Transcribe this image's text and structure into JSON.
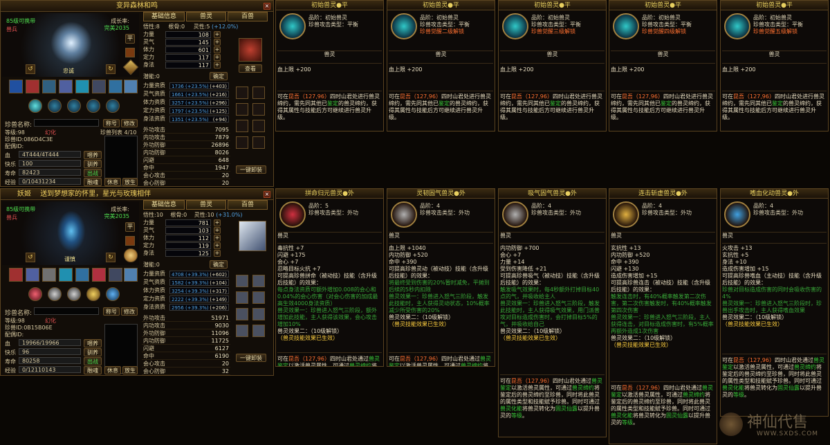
{
  "top_panel": {
    "title": "变异森林和鸣",
    "tabs": [
      "基础信息",
      "兽灵",
      "百兽"
    ],
    "carry": "85级可携带",
    "type_label": "兽兵",
    "growth_label": "成长率:",
    "growth_value": "完美2035",
    "pet_name_title": "忠诚",
    "pet_name_label": "珍兽名称:",
    "btn_title": "称号",
    "btn_modify": "修改",
    "btn_pin": "平",
    "level": "等级:98",
    "phantom": "幻化",
    "pet_id": "珍兽ID:086D4C3E",
    "spouse": "配偶ID:",
    "pet_list": "珍兽列表 4/10",
    "hp_label": "血",
    "hp_value": "4T444/4T444",
    "feed": "喂养",
    "happy_label": "快乐",
    "happy_value": "100",
    "tame": "驯养",
    "life_label": "寿命",
    "life_value": "82423",
    "out": "出战",
    "exp_label": "经验",
    "exp_value": "0/10431234",
    "btn_breed": "融魂",
    "btn_rest": "休息",
    "btn_release": "放生",
    "savvy": "悟性:8",
    "bone": "根骨:0",
    "spirit": "灵性:5",
    "spirit_bonus": "(+12.0%)",
    "attrs": [
      {
        "k": "力量",
        "v": "108"
      },
      {
        "k": "灵气",
        "v": "145"
      },
      {
        "k": "体力",
        "v": "601"
      },
      {
        "k": "定力",
        "v": "117"
      },
      {
        "k": "身法",
        "v": "117"
      }
    ],
    "potential": "潜能:0",
    "confirm": "确定",
    "look": "查看",
    "aptitudes": [
      {
        "k": "力量资质",
        "v": "1736 (+23.5%)",
        "b": "(+403)"
      },
      {
        "k": "灵气资质",
        "v": "1661 (+23.5%)",
        "b": "(+216)"
      },
      {
        "k": "体力资质",
        "v": "3257 (+23.5%)",
        "b": "(+296)"
      },
      {
        "k": "定力资质",
        "v": "1797 (+23.5%)",
        "b": "(+125)"
      },
      {
        "k": "身法资质",
        "v": "1351 (+23.5%)",
        "b": "(+94)"
      }
    ],
    "combat": [
      {
        "k": "外功攻击",
        "v": "7095"
      },
      {
        "k": "内功攻击",
        "v": "7879"
      },
      {
        "k": "外功防御",
        "v": "26896"
      },
      {
        "k": "内功防御",
        "v": "8026"
      },
      {
        "k": "闪避",
        "v": "648"
      },
      {
        "k": "命中",
        "v": "1947"
      },
      {
        "k": "会心攻击",
        "v": "20"
      },
      {
        "k": "会心防御",
        "v": "20"
      }
    ],
    "unload": "一键卸装"
  },
  "bottom_panel": {
    "title": "妖姬",
    "banner": "送到梦想家的怀里，星光与玫瑰相伴",
    "tabs": [
      "基础信息",
      "兽灵",
      "百兽"
    ],
    "carry": "85级可携带",
    "type_label": "兽兵",
    "growth_label": "成长率:",
    "growth_value": "完美2035",
    "pet_name_title": "谨慎",
    "pet_name_label": "珍兽名称:",
    "btn_title": "称号",
    "btn_modify": "修改",
    "btn_pin": "平",
    "level": "等级:98",
    "phantom": "幻化",
    "pet_id": "珍兽ID:0B15B06E",
    "spouse": "配偶ID:",
    "hp_label": "血",
    "hp_value": "19966/19966",
    "feed": "喂养",
    "happy_label": "快乐",
    "happy_value": "96",
    "tame": "驯养",
    "life_label": "寿命",
    "life_value": "80258",
    "out": "出战",
    "exp_label": "经验",
    "exp_value": "0/12110143",
    "btn_breed": "融魂",
    "btn_rest": "休息",
    "btn_release": "放生",
    "savvy": "悟性:10",
    "bone": "根骨:0",
    "spirit": "灵性:10",
    "spirit_bonus": "(+31.0%)",
    "attrs": [
      {
        "k": "力量",
        "v": "781"
      },
      {
        "k": "灵气",
        "v": "103"
      },
      {
        "k": "体力",
        "v": "112"
      },
      {
        "k": "定力",
        "v": "119"
      },
      {
        "k": "身法",
        "v": "125"
      }
    ],
    "potential": "潜能:0",
    "confirm": "确定",
    "aptitudes": [
      {
        "k": "力量资质",
        "v": "4708 (+39.3%)",
        "b": "(+602)"
      },
      {
        "k": "灵气资质",
        "v": "1582 (+39.3%)",
        "b": "(+104)"
      },
      {
        "k": "体力资质",
        "v": "3254 (+39.3%)",
        "b": "(+317)"
      },
      {
        "k": "定力资质",
        "v": "2222 (+39.3%)",
        "b": "(+149)"
      },
      {
        "k": "身法资质",
        "v": "2956 (+39.3%)",
        "b": "(+206)"
      }
    ],
    "combat": [
      {
        "k": "外功攻击",
        "v": "51971"
      },
      {
        "k": "内功攻击",
        "v": "9030"
      },
      {
        "k": "外功防御",
        "v": "11096"
      },
      {
        "k": "内功防御",
        "v": "11725"
      },
      {
        "k": "闪避",
        "v": "6127"
      },
      {
        "k": "命中",
        "v": "6190"
      },
      {
        "k": "会心攻击",
        "v": "20"
      },
      {
        "k": "会心防御",
        "v": "32"
      }
    ],
    "unload": "一键卸装"
  },
  "top_cards": [
    {
      "title": "初始兽灵●平",
      "grade": "品阶：初始兽灵",
      "atk_type": "珍兽攻击类型：平衡",
      "unlock": "",
      "stat": "血上限 +200",
      "orb_color": "#30c8c8"
    },
    {
      "title": "初始兽灵●平",
      "grade": "品阶：初始兽灵",
      "atk_type": "珍兽攻击类型：平衡",
      "unlock": "珍兽觉醒二级解锁",
      "stat": "血上限 +200",
      "orb_color": "#30c8c8"
    },
    {
      "title": "初始兽灵●平",
      "grade": "品阶：初始兽灵",
      "atk_type": "珍兽攻击类型：平衡",
      "unlock": "珍兽觉醒三级解锁",
      "stat": "血上限 +200",
      "orb_color": "#30c8c8"
    },
    {
      "title": "初始兽灵●平",
      "grade": "品阶：初始兽灵",
      "atk_type": "珍兽攻击类型：平衡",
      "unlock": "珍兽觉醒四级解锁",
      "stat": "血上限 +200",
      "orb_color": "#30c8c8"
    },
    {
      "title": "初始兽灵●平",
      "grade": "品阶：初始兽灵",
      "atk_type": "珍兽攻击类型：平衡",
      "unlock": "珍兽觉醒五级解锁",
      "stat": "血上限 +200",
      "orb_color": "#30c8c8"
    }
  ],
  "top_card_common": {
    "label": "兽灵",
    "desc_1": "可在",
    "desc_place": "昆吾（127,96）",
    "desc_2": "四时山君处进行兽灵缔约，需先同其他已",
    "desc_identify": "鉴定",
    "desc_3": "的兽灵缔约，获得其属性与技能后方可继续进行兽灵升级。"
  },
  "bottom_cards": [
    {
      "title": "拼命归元兽灵●外",
      "grade": "品阶：5",
      "atk_type": "珍兽攻击类型：外功",
      "orb_color": "#d03040",
      "stats": [
        "毒抗性 +7",
        "闪避 +175",
        "会心 +7"
      ],
      "extra": "忍略目标火抗 +7",
      "skill_head": "可提高珍兽拼命（被动技）技能（含升级后技能）的效果：",
      "skill_lines": [
        "每点身法资质可额外增加0.008的会心和0.04%的会心伤害（对会心伤害的加成最高生效4000身法资质）",
        "兽灵效果一：珍兽进入怒气三阶段，额外增加此技能，主人获得该效果，会心攻击增加10%"
      ],
      "effect2": "兽灵效果二：（10级解锁）",
      "ready": "（兽灵技能效果已生效）"
    },
    {
      "title": "灵韧固气兽灵●外",
      "grade": "品阶：4",
      "atk_type": "珍兽攻击类型：外功",
      "orb_color": "#b0b0b0",
      "stats": [
        "血上限 +1040",
        "内功防御 +520",
        "命中 +390"
      ],
      "extra": "",
      "skill_head": "可提高珍兽灵动（被动技）技能（含升级后技能）的效果：",
      "skill_lines": [
        "将最终受到伤害的20%暂时减免，平摊到后续的5秒内扣除",
        "兽灵效果一：珍兽进入怒气三阶段，触发此技能时，主人获得灵动状态，10%概率减少所受伤害的20%"
      ],
      "effect2": "兽灵效果二：（10级解锁）",
      "ready": "（兽灵技能效果已生效）"
    },
    {
      "title": "吸气固气兽灵●外",
      "grade": "品阶：4",
      "atk_type": "珍兽攻击类型：外功",
      "orb_color": "#b0b0b0",
      "stats": [
        "内功防御 +700",
        "会心 +7",
        "力量 +14"
      ],
      "extra": "受到伤害降低 +21",
      "skill_head": "可提高珍兽吸气（被动技）技能（含升级后技能）的效果：",
      "skill_lines": [
        "触发吸气效果时，每4秒额外打掉目标40点的气，并吸收给主人",
        "兽灵效果一：珍兽进入怒气三阶段，触发此技能时，主人获得吸气效果，用门派普攻对目标造成伤害时，会打掉目标5%的气，并吸收给自己"
      ],
      "effect2": "兽灵效果二：（10级解锁）",
      "ready": "（兽灵技能效果已生效）"
    },
    {
      "title": "连击斩虚兽灵●外",
      "grade": "品阶：4",
      "atk_type": "珍兽攻击类型：外功",
      "orb_color": "#e0b040",
      "stats": [
        "玄抗性 +13",
        "内功防御 +520",
        "命中 +390",
        "闪避 +130"
      ],
      "extra": "造成伤害增加 +15",
      "skill_head": "可提高珍兽连击（被动技）技能（含升级后技能）的效果：",
      "skill_lines": [
        "触发连击时，有40%概率触发第二次伤害，第二次伤害触发时，有40%概率触发第四次伤害",
        "兽灵效果一：珍兽进入怒气三阶段，主人获得连击，对目标造成伤害时，有5%概率再额外造成1次伤害"
      ],
      "effect2": "兽灵效果二：（10级解锁）",
      "ready": "（兽灵技能效果已生效）"
    },
    {
      "title": "嗜血化动兽灵●外",
      "grade": "品阶：4",
      "atk_type": "珍兽攻击类型：外功",
      "orb_color": "#40a0e0",
      "stats": [
        "火攻击 +13",
        "玄抗性 +5",
        "身法 +10"
      ],
      "extra": "造成伤害增加 +15",
      "skill_head": "可提高珍兽嗜血（主动技）技能（含升级后技能）的效果：",
      "skill_lines": [
        "珍兽对目标造成伤害的同时会吸收伤害的4%",
        "兽灵效果一：珍兽进入怒气三阶段时，珍兽出手攻击时，主人获得嗜血效果"
      ],
      "effect2": "兽灵效果二：（10级解锁）",
      "ready": "（兽灵技能效果已生效）"
    }
  ],
  "bottom_card_common": {
    "label": "兽灵",
    "desc_1": "可在",
    "desc_place": "昆吾（127,96）",
    "desc_2": "四时山君处通过",
    "desc_identify": "兽灵鉴定",
    "desc_3": "以激活兽灵属性，可通过",
    "desc_contract": "兽灵缔约",
    "desc_4": "将鉴定后的兽灵缔约至珍兽，同时将此兽灵的属性类型和技能赋予珍兽。同时可通过",
    "desc_transform": "兽灵化能",
    "desc_5": "将兽灵转化为",
    "desc_essence": "固灵仙露",
    "desc_6": "以提升兽灵的",
    "desc_grade": "等级",
    "desc_end": "。"
  },
  "watermark": {
    "title": "神仙代售",
    "url": "WWW.SXDS.COM"
  }
}
